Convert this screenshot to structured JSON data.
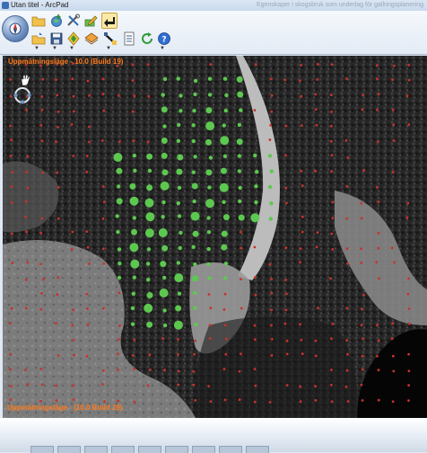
{
  "window": {
    "title": "Utan titel - ArcPad",
    "hint": "Egenskaper i skogsbruk som underlag för gallringsplanering"
  },
  "toolbar": {
    "items": [
      {
        "name": "folder-open-icon",
        "row": 1
      },
      {
        "name": "add-layer-icon",
        "row": 1
      },
      {
        "name": "tools-icon",
        "row": 1
      },
      {
        "name": "edit-pen-icon",
        "row": 1
      },
      {
        "name": "back-arrow-icon",
        "row": 1,
        "active": true
      },
      {
        "name": "open-map-icon",
        "row": 2
      },
      {
        "name": "save-icon",
        "row": 2
      },
      {
        "name": "gps-position-icon",
        "row": 2
      },
      {
        "name": "layer-style-icon",
        "row": 2
      },
      {
        "name": "gps-tools-icon",
        "row": 2
      },
      {
        "name": "table-icon",
        "row": 2
      },
      {
        "name": "refresh-icon",
        "row": 2
      },
      {
        "name": "help-icon",
        "row": 2
      }
    ]
  },
  "map": {
    "scale_top": "Uppmätningsläge - 10.0 (Build 19)",
    "scale_bottom": "Uppmätningsläge - (10.0 Build 19)",
    "point_colors": {
      "sample": "#5dc850",
      "plot": "#c8332a"
    },
    "accent": "#ff7a1a"
  }
}
